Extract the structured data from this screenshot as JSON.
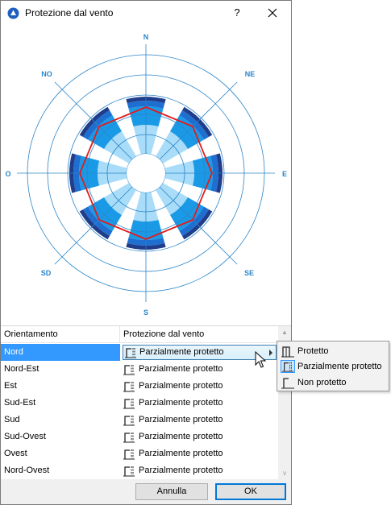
{
  "window": {
    "title": "Protezione dal vento",
    "help_label": "?"
  },
  "compass": {
    "N": "N",
    "NE": "NE",
    "E": "E",
    "SE": "SE",
    "S": "S",
    "SD": "SD",
    "O": "O",
    "NO": "NO"
  },
  "colors": {
    "ring_outer": "#1f3d8a",
    "ring_mid": "#1f6fd0",
    "ring_main": "#1a9ae6",
    "ring_inner": "#a8dcf8",
    "protection_line": "#e21b1b",
    "grid": "#2a85c9",
    "selection": "#3399ff"
  },
  "list": {
    "headers": {
      "orientation": "Orientamento",
      "protection": "Protezione dal vento"
    },
    "rows": [
      {
        "orientation": "Nord",
        "protection": "Parzialmente protetto",
        "icon": "partially-protected-icon",
        "selected": true
      },
      {
        "orientation": "Nord-Est",
        "protection": "Parzialmente protetto",
        "icon": "partially-protected-icon"
      },
      {
        "orientation": "Est",
        "protection": "Parzialmente protetto",
        "icon": "partially-protected-icon"
      },
      {
        "orientation": "Sud-Est",
        "protection": "Parzialmente protetto",
        "icon": "partially-protected-icon"
      },
      {
        "orientation": "Sud",
        "protection": "Parzialmente protetto",
        "icon": "partially-protected-icon"
      },
      {
        "orientation": "Sud-Ovest",
        "protection": "Parzialmente protetto",
        "icon": "partially-protected-icon"
      },
      {
        "orientation": "Ovest",
        "protection": "Parzialmente protetto",
        "icon": "partially-protected-icon"
      },
      {
        "orientation": "Nord-Ovest",
        "protection": "Parzialmente protetto",
        "icon": "partially-protected-icon"
      }
    ]
  },
  "popup": {
    "items": [
      {
        "label": "Protetto",
        "icon": "protected-icon",
        "checked": false
      },
      {
        "label": "Parzialmente protetto",
        "icon": "partially-protected-icon",
        "checked": true
      },
      {
        "label": "Non protetto",
        "icon": "not-protected-icon",
        "checked": false
      }
    ]
  },
  "footer": {
    "cancel_label": "Annulla",
    "ok_label": "OK"
  }
}
